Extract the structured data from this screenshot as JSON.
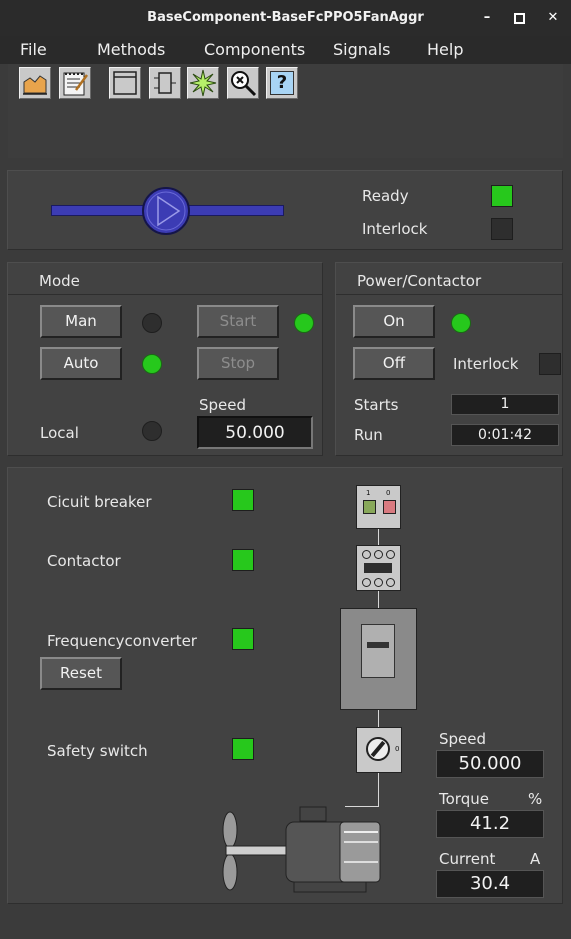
{
  "window": {
    "title": "BaseComponent-BaseFcPPO5FanAggr",
    "minimize": "–",
    "maximize": "▪",
    "close": "✕"
  },
  "menu": [
    "File",
    "Methods",
    "Components",
    "Signals",
    "Help"
  ],
  "toolbar": {
    "buttons": [
      "trend-icon",
      "notes-icon",
      "window-icon",
      "component-icon",
      "sparkle-icon",
      "inspect-icon",
      "help-icon"
    ],
    "help_glyph": "?"
  },
  "status": {
    "ready_label": "Ready",
    "ready": true,
    "interlock_label": "Interlock",
    "interlock": false
  },
  "mode": {
    "title": "Mode",
    "man_label": "Man",
    "auto_label": "Auto",
    "local_label": "Local",
    "start_label": "Start",
    "stop_label": "Stop",
    "speed_label": "Speed",
    "speed_value": "50.000",
    "man_active": false,
    "auto_active": true,
    "local_active": false,
    "start_active": true
  },
  "power": {
    "title": "Power/Contactor",
    "on_label": "On",
    "off_label": "Off",
    "interlock_label": "Interlock",
    "starts_label": "Starts",
    "starts_value": "1",
    "run_label": "Run",
    "run_value": "0:01:42",
    "on_active": true
  },
  "chain": {
    "breaker_label": "Cicuit breaker",
    "contactor_label": "Contactor",
    "fc_label": "Frequencyconverter",
    "reset_label": "Reset",
    "safety_label": "Safety switch",
    "breaker_on": true,
    "contactor_on": true,
    "fc_on": true,
    "safety_on": true,
    "breaker_digits": [
      "1",
      "0"
    ],
    "safety_digit": "0"
  },
  "readouts": {
    "speed_label": "Speed",
    "speed_value": "50.000",
    "torque_label": "Torque",
    "torque_unit": "%",
    "torque_value": "41.2",
    "current_label": "Current",
    "current_unit": "A",
    "current_value": "30.4"
  },
  "colors": {
    "led_on": "#26c81c",
    "background": "#3b3b3b",
    "pump": "#3c3cb4"
  }
}
